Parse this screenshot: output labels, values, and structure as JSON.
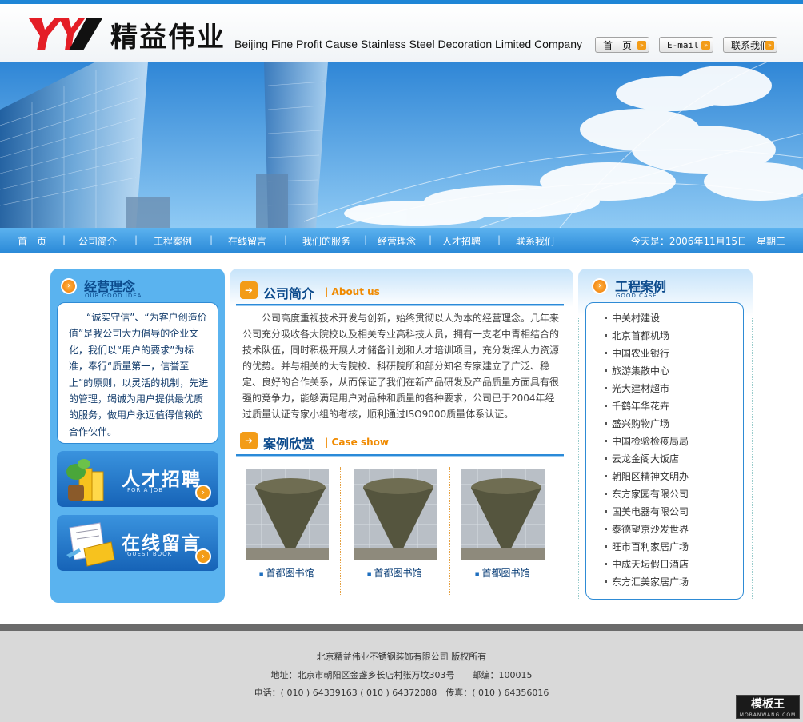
{
  "header": {
    "logo_cn": "精益伟业",
    "logo_en": "Beijing Fine Profit Cause Stainless Steel Decoration Limited Company",
    "btn_home": "首　页",
    "btn_email": "E-mail",
    "btn_contact": "联系我们"
  },
  "nav": {
    "items": [
      "首　页",
      "公司简介",
      "工程案例",
      "在线留言",
      "我们的服务",
      "经营理念",
      "人才招聘",
      "联系我们"
    ],
    "date": "今天是：2006年11月15日　星期三"
  },
  "left": {
    "idea_title": "经营理念",
    "idea_sub": "OUR GOOD IDEA",
    "idea_text": "“诚实守信”、“为客户创造价值”是我公司大力倡导的企业文化，我们以“用户的要求”为标准，奉行“质量第一，信誉至上”的原则，以灵活的机制，先进的管理，竭诚为用户提供最优质的服务，做用户永远值得信赖的合作伙伴。",
    "jobs_title": "人才招聘",
    "jobs_sub": "FOR A JOB",
    "guest_title": "在线留言",
    "guest_sub": "GUEST BOOK"
  },
  "center": {
    "about_title": "公司简介",
    "about_en": "| About us",
    "about_text": "公司高度重视技术开发与创新，始终贯彻以人为本的经营理念。几年来公司充分吸收各大院校以及相关专业高科技人员，拥有一支老中青相结合的技术队伍，同时积极开展人才储备计划和人才培训项目，充分发挥人力资源的优势。并与相关的大专院校、科研院所和部分知名专家建立了广泛、稳定、良好的合作关系，从而保证了我们在新产品研发及产品质量方面具有很强的竞争力，能够满足用户对品种和质量的各种要求，公司已于2004年经过质量认证专家小组的考核，顺利通过ISO9000质量体系认证。",
    "case_title": "案例欣赏",
    "case_en": "| Case show",
    "cases": [
      "首都图书馆",
      "首都图书馆",
      "首都图书馆"
    ]
  },
  "right": {
    "title": "工程案例",
    "sub": "GOOD CASE",
    "items": [
      "中关村建设",
      "北京首都机场",
      "中国农业银行",
      "旅游集散中心",
      "光大建材超市",
      "千鹤年华花卉",
      "盛兴购物广场",
      "中国检验检疫局局",
      "云龙金阁大饭店",
      "朝阳区精神文明办",
      "东方家园有限公司",
      "国美电器有限公司",
      "泰德望京沙发世界",
      "旺市百利家居广场",
      "中成天坛假日酒店",
      "东方汇美家居广场"
    ]
  },
  "footer": {
    "line1": "北京精益伟业不锈钢装饰有限公司 版权所有",
    "line2": "地址：北京市朝阳区金盏乡长店村张万坟303号　　邮编：100015",
    "line3": "电话：( 010 ) 64339163 ( 010 ) 64372088　传真：( 010 ) 64356016",
    "watermark": "模板王",
    "watermark_url": "MOBANWANG.COM"
  }
}
